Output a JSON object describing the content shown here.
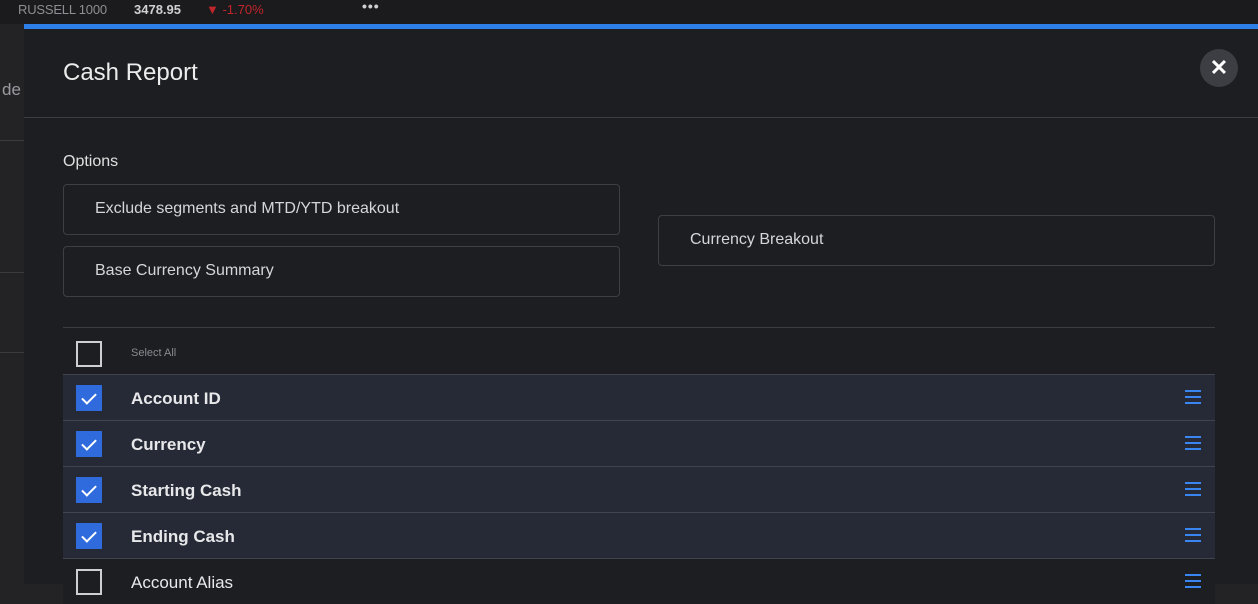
{
  "ticker": {
    "name": "RUSSELL 1000",
    "value": "3478.95",
    "change": "▼ -1.70%",
    "more": "•••"
  },
  "background": {
    "partial_text": "de"
  },
  "modal": {
    "title": "Cash Report",
    "close_glyph": "✕",
    "accent_color": "#2f7fe8"
  },
  "options": {
    "label": "Options",
    "buttons": [
      "Exclude segments and MTD/YTD breakout",
      "Base Currency Summary",
      "Currency Breakout"
    ]
  },
  "fields": {
    "select_all_label": "Select All",
    "items": [
      {
        "label": "Account ID",
        "checked": true
      },
      {
        "label": "Currency",
        "checked": true
      },
      {
        "label": "Starting Cash",
        "checked": true
      },
      {
        "label": "Ending Cash",
        "checked": true
      },
      {
        "label": "Account Alias",
        "checked": false
      }
    ]
  },
  "icons": {
    "close": "close-icon",
    "drag": "drag-handle-icon",
    "check": "checkmark-icon"
  }
}
